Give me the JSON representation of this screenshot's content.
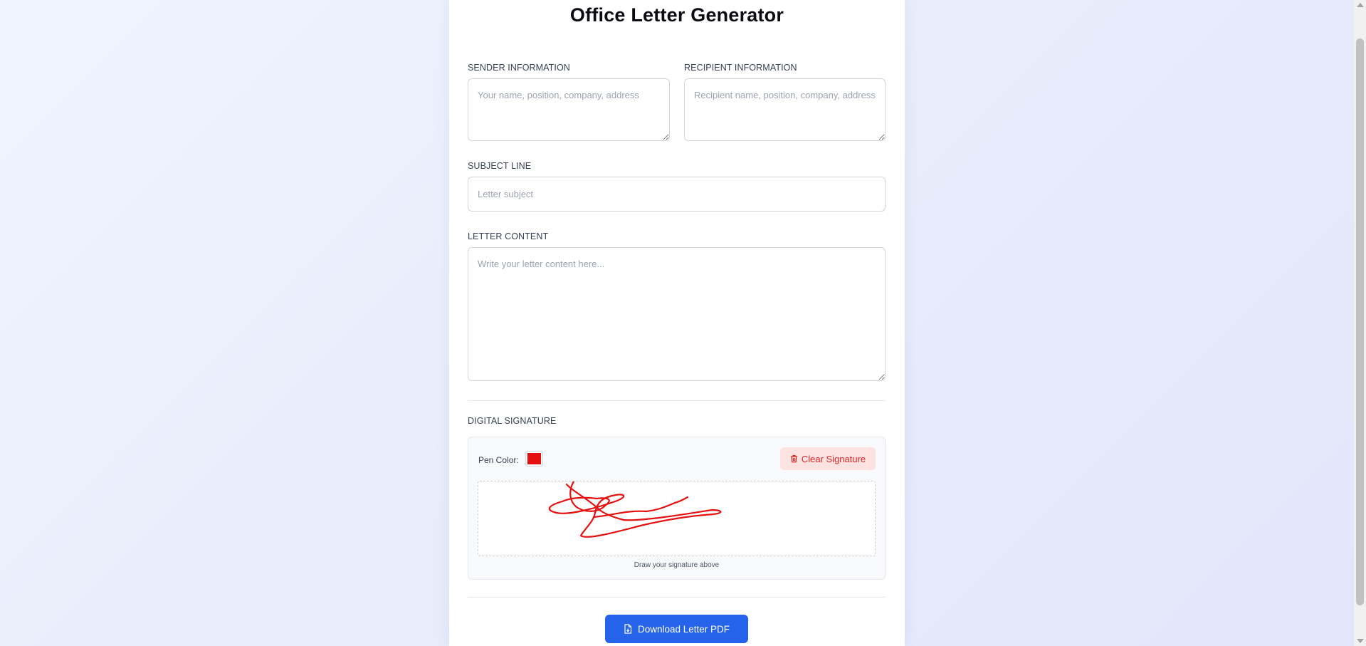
{
  "app": {
    "title": "Office Letter Generator"
  },
  "sender": {
    "label": "SENDER INFORMATION",
    "placeholder": "Your name, position, company, address",
    "value": ""
  },
  "recipient": {
    "label": "RECIPIENT INFORMATION",
    "placeholder": "Recipient name, position, company, address",
    "value": ""
  },
  "subject": {
    "label": "SUBJECT LINE",
    "placeholder": "Letter subject",
    "value": ""
  },
  "content": {
    "label": "LETTER CONTENT",
    "placeholder": "Write your letter content here...",
    "value": ""
  },
  "signature": {
    "label": "DIGITAL SIGNATURE",
    "pen_color_label": "Pen Color:",
    "pen_color": "#e51111",
    "clear_label": "Clear Signature",
    "hint": "Draw your signature above"
  },
  "actions": {
    "download_label": "Download Letter PDF"
  },
  "colors": {
    "accent": "#2563eb",
    "danger": "#dc2626",
    "danger_bg": "#fde2e2"
  },
  "icons": {
    "clear": "trash-icon",
    "download": "file-download-icon"
  }
}
